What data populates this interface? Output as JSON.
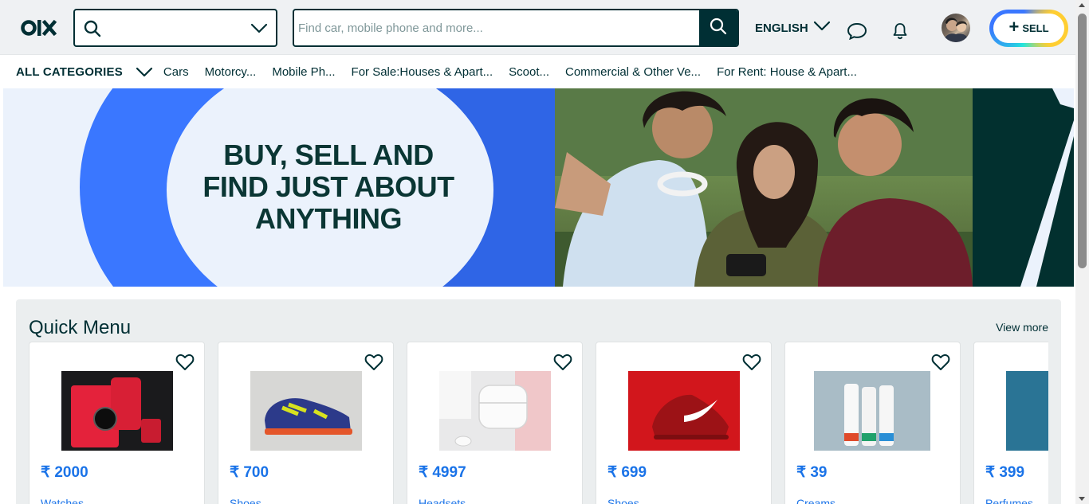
{
  "header": {
    "logo_text": "olx",
    "location": {
      "value": ""
    },
    "search": {
      "placeholder": "Find car, mobile phone and more..."
    },
    "language": "ENGLISH",
    "sell_label": "SELL"
  },
  "categories": {
    "all_label": "ALL CATEGORIES",
    "items": [
      "Cars",
      "Motorcy...",
      "Mobile Ph...",
      "For Sale:Houses & Apart...",
      "Scoot...",
      "Commercial & Other Ve...",
      "For Rent: House & Apart..."
    ]
  },
  "banner": {
    "line1": "BUY, SELL AND",
    "line2": "FIND JUST ABOUT",
    "line3": "ANYTHING"
  },
  "quick_menu": {
    "title": "Quick Menu",
    "view_more": "View more",
    "cards": [
      {
        "price": "₹ 2000",
        "label": "Watches"
      },
      {
        "price": "₹ 700",
        "label": "Shoes"
      },
      {
        "price": "₹ 4997",
        "label": "Headsets"
      },
      {
        "price": "₹ 699",
        "label": "Shoes"
      },
      {
        "price": "₹ 39",
        "label": "Creams"
      },
      {
        "price": "₹ 399",
        "label": "Perfumes"
      }
    ]
  },
  "colors": {
    "primary": "#002f34",
    "link_blue": "#1a73e8",
    "banner_blue": "#3a77ff"
  }
}
